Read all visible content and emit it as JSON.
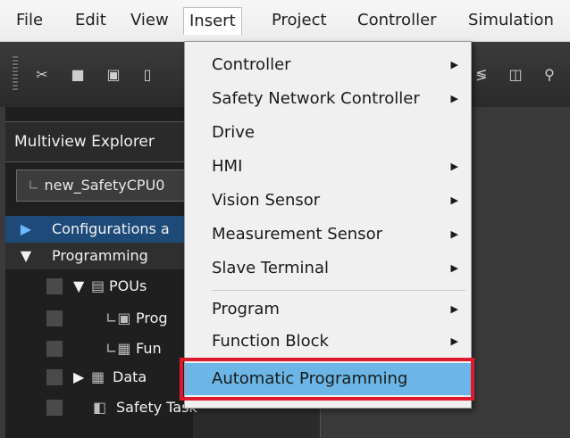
{
  "menubar": {
    "items": [
      "File",
      "Edit",
      "View",
      "Insert",
      "Project",
      "Controller",
      "Simulation"
    ],
    "active_index": 3
  },
  "explorer": {
    "title": "Multiview Explorer",
    "device": "new_SafetyCPU0",
    "tree": {
      "configurations": "Configurations a",
      "programming": "Programming",
      "pous": "POUs",
      "programs": "Prog",
      "functions": "Fun",
      "data": "Data",
      "safety_task": "Safety Task"
    }
  },
  "insert_menu": {
    "items": [
      {
        "label": "Controller",
        "submenu": true
      },
      {
        "label": "Safety Network Controller",
        "submenu": true
      },
      {
        "label": "Drive",
        "submenu": false
      },
      {
        "label": "HMI",
        "submenu": true
      },
      {
        "label": "Vision Sensor",
        "submenu": true
      },
      {
        "label": "Measurement Sensor",
        "submenu": true
      },
      {
        "label": "Slave Terminal",
        "submenu": true
      },
      {
        "label": "Program",
        "submenu": true
      },
      {
        "label": "Function Block",
        "submenu": true
      },
      {
        "label": "Automatic Programming",
        "submenu": false,
        "highlighted": true
      }
    ]
  },
  "colors": {
    "highlight": "#6bb6e6",
    "annotation_border": "#e0182b",
    "tree_selected": "#1e4a7a"
  }
}
